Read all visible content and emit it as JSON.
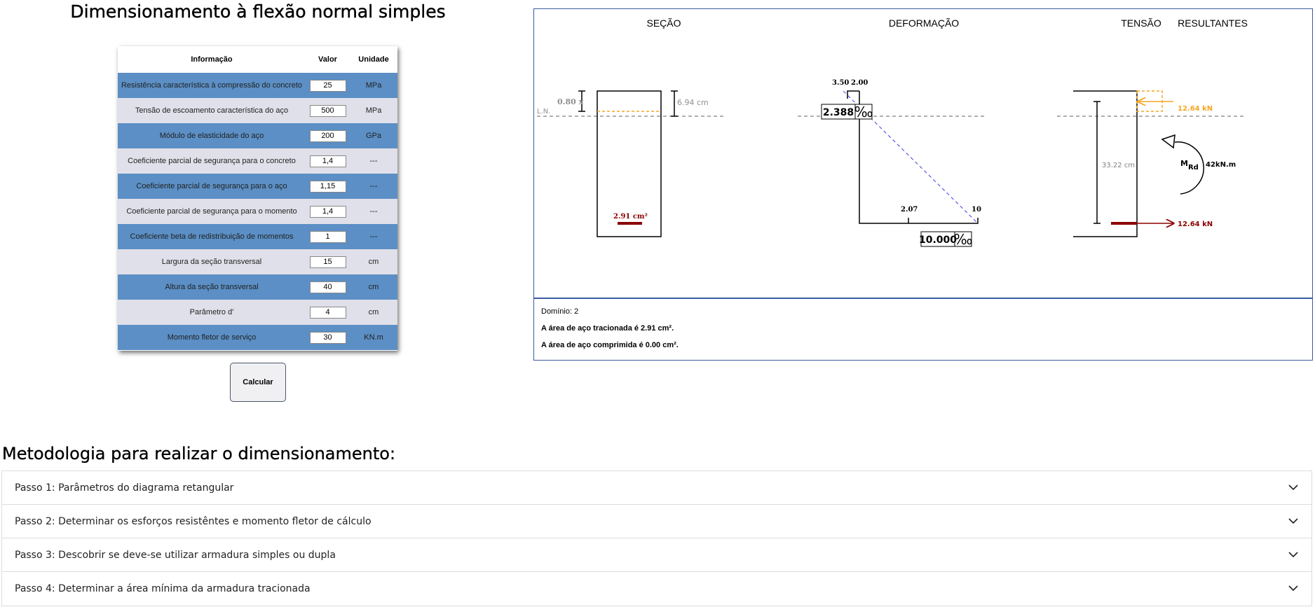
{
  "title": "Dimensionamento à flexão normal simples",
  "table": {
    "headers": [
      "Informação",
      "Valor",
      "Unidade"
    ],
    "rows": [
      {
        "label": "Resistência característica à compressão do concreto",
        "value": "25",
        "unit": "MPa"
      },
      {
        "label": "Tensão de escoamento característica do aço",
        "value": "500",
        "unit": "MPa"
      },
      {
        "label": "Módulo de elasticidade do aço",
        "value": "200",
        "unit": "GPa"
      },
      {
        "label": "Coeficiente parcial de segurança para o concreto",
        "value": "1,4",
        "unit": "---"
      },
      {
        "label": "Coeficiente parcial de segurança para o aço",
        "value": "1,15",
        "unit": "---"
      },
      {
        "label": "Coeficiente parcial de segurança para o momento",
        "value": "1,4",
        "unit": "---"
      },
      {
        "label": "Coeficiente beta de redistribuição de momentos",
        "value": "1",
        "unit": "---"
      },
      {
        "label": "Largura da seção transversal",
        "value": "15",
        "unit": "cm"
      },
      {
        "label": "Altura da seção transversal",
        "value": "40",
        "unit": "cm"
      },
      {
        "label": "Parâmetro d'",
        "value": "4",
        "unit": "cm"
      },
      {
        "label": "Momento fletor de serviço",
        "value": "30",
        "unit": "KN.m"
      }
    ]
  },
  "calc_button": "Calcular",
  "diagram": {
    "titles": {
      "secao": "SEÇÃO",
      "deformacao": "DEFORMAÇÃO",
      "tensao": "TENSÃO",
      "resultantes": "RESULTANTES"
    },
    "secao": {
      "x_label": "0.80 x",
      "ln_label": "L.N.",
      "dim_label": "6.94 cm",
      "area_label": "2.91 cm²"
    },
    "deformacao": {
      "top_left": "3.50",
      "top_right": "2.00",
      "box_top": "2.388",
      "bottom_left": "2.07",
      "bottom_right": "10",
      "box_bottom": "10.000",
      "permil": "‰"
    },
    "tensao": {
      "height_label": "33.22 cm",
      "force_top": "12.64 kN",
      "force_bottom": "12.64 kN",
      "moment_label": "M",
      "moment_sub": "Rd",
      "moment_value": "42kN.m"
    },
    "colors": {
      "accent": "#f5a623",
      "steel": "#8b0000",
      "neutral": "#808080",
      "strain": "#5a5ae6"
    }
  },
  "results": {
    "dominio": "Domínio: 2",
    "line1": "A área de aço tracionada é 2.91 cm².",
    "line2": "A área de aço comprimida é 0.00 cm²."
  },
  "methodology": {
    "heading": "Metodologia para realizar o dimensionamento:",
    "steps": [
      "Passo 1: Parâmetros do diagrama retangular",
      "Passo 2: Determinar os esforços resistêntes e momento fletor de cálculo",
      "Passo 3: Descobrir se deve-se utilizar armadura simples ou dupla",
      "Passo 4: Determinar a área mínima da armadura tracionada"
    ]
  }
}
